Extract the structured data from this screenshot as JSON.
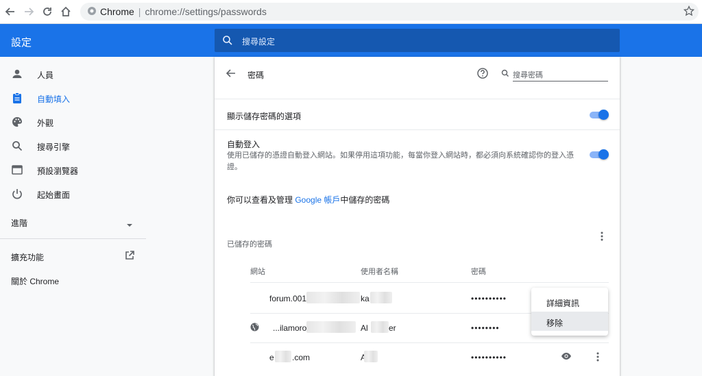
{
  "browser": {
    "site_label": "Chrome",
    "url": "chrome://settings/passwords"
  },
  "header": {
    "title": "設定",
    "search_placeholder": "搜尋設定"
  },
  "sidebar": {
    "items": [
      {
        "label": "人員",
        "icon": "person-icon"
      },
      {
        "label": "自動填入",
        "icon": "clipboard-icon"
      },
      {
        "label": "外觀",
        "icon": "palette-icon"
      },
      {
        "label": "搜尋引擎",
        "icon": "search-icon"
      },
      {
        "label": "預設瀏覽器",
        "icon": "browser-icon"
      },
      {
        "label": "起始畫面",
        "icon": "power-icon"
      }
    ],
    "advanced": "進階",
    "extensions": "擴充功能",
    "about": "關於 Chrome"
  },
  "passwords": {
    "title": "密碼",
    "search_placeholder": "搜尋密碼",
    "offer_to_save": "顯示儲存密碼的選項",
    "auto_signin_title": "自動登入",
    "auto_signin_desc": "使用已儲存的憑證自動登入網站。如果停用這項功能，每當你登入網站時，都必須向系統確認你的登入憑證。",
    "google_prefix": "你可以查看及管理 ",
    "google_link": "Google 帳戶",
    "google_suffix": "中儲存的密碼",
    "saved_heading": "已儲存的密碼",
    "col_site": "網站",
    "col_username": "使用者名稱",
    "col_password": "密碼",
    "rows": [
      {
        "site": "forum.001-",
        "username": "ka",
        "password": "••••••••••"
      },
      {
        "site": "...ilamoros",
        "username": "Al",
        "username_tail": "er",
        "password": "••••••••"
      },
      {
        "site_prefix": "e",
        "site": ".com",
        "username": "A",
        "password": "••••••••••"
      }
    ]
  },
  "menu": {
    "details": "詳細資訊",
    "remove": "移除"
  },
  "colors": {
    "accent": "#1a73e8",
    "header": "#1a73e8"
  }
}
